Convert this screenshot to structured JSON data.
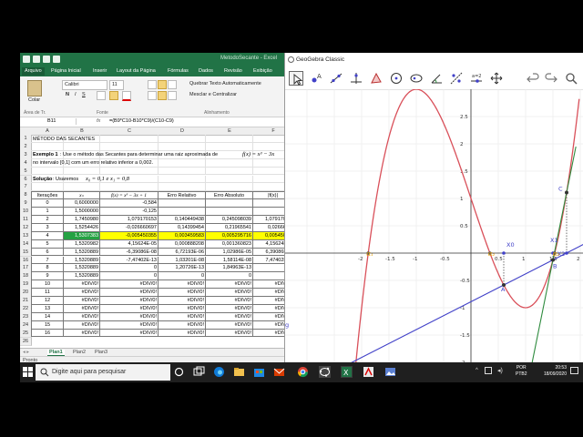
{
  "excel": {
    "title": "MetodoSecante - Excel",
    "tabs": [
      "Arquivo",
      "Página Inicial",
      "Inserir",
      "Layout da Página",
      "Fórmulas",
      "Dados",
      "Revisão",
      "Exibição"
    ],
    "ribbon": {
      "paste": "Colar",
      "font_name": "Calibri",
      "font_size": "11",
      "wrap_text": "Quebrar Texto Automaticamente",
      "merge_center": "Mesclar e Centralizar",
      "group_clipboard": "Área de Tr.",
      "group_font": "Fonte",
      "group_alignment": "Alinhamento"
    },
    "name_box": "B11",
    "fx": "fx",
    "formula": "=(B9*C10-B10*C9)/(C10-C9)",
    "columns": [
      "A",
      "B",
      "C",
      "D",
      "E",
      "F"
    ],
    "rows": [
      "1",
      "2",
      "3",
      "4",
      "5",
      "6",
      "7",
      "8",
      "9",
      "10",
      "11",
      "12",
      "13",
      "14",
      "15",
      "16",
      "17",
      "18",
      "19",
      "20",
      "21",
      "22",
      "23",
      "24",
      "25",
      "26"
    ],
    "heading": "MÉTODO DAS SECANTES",
    "exemplo_bold": "Exemplo 1",
    "exemplo_text": ": Use o método das Secantes para determinar uma raiz aproximada de",
    "exemplo_fx": "f(x) = x³ − 3x",
    "interval_text": "no intervalo [0,1] com um erro relativo inferior a 0,002.",
    "solucao_bold": "Solução",
    "solucao_text": ": Usaremos",
    "solucao_values": "x₀ = 0,1  e  x₁ = 0,8",
    "table_headers": [
      "Iterações",
      "xₙ",
      "f(x) = x³ − 3x + 1",
      "Erro Relativo",
      "Erro Absoluto",
      "|f(x)|"
    ],
    "table_rows": [
      [
        "0",
        "0,6000000",
        "-0,584",
        "",
        "",
        ""
      ],
      [
        "1",
        "1,5000000",
        "-0,125",
        "",
        "",
        ""
      ],
      [
        "2",
        "1,7450980",
        "1,079170153",
        "0,140449438",
        "0,245098039",
        "1,07917015"
      ],
      [
        "3",
        "1,5254426",
        "-0,026660697",
        "0,14399454",
        "0,21965541",
        "0,0266606"
      ],
      [
        "4",
        "1,5307383",
        "-0,005450355",
        "0,003459583",
        "0,005295716",
        "0,00545035"
      ],
      [
        "5",
        "1,5320982",
        "4,15624E-05",
        "0,000888208",
        "0,001360823",
        "4,15624E-0"
      ],
      [
        "6",
        "1,5320889",
        "-6,39086E-08",
        "6,72193E-06",
        "1,02986E-05",
        "6,39086E-0"
      ],
      [
        "7",
        "1,5320889",
        "-7,47402E-13",
        "1,03201E-08",
        "1,58114E-08",
        "7,47402E-1"
      ],
      [
        "8",
        "1,5320889",
        "0",
        "1,20726E-13",
        "1,84963E-13",
        "0"
      ],
      [
        "9",
        "1,5320889",
        "0",
        "0",
        "0",
        "0"
      ],
      [
        "10",
        "#DIV/0!",
        "#DIV/0!",
        "#DIV/0!",
        "#DIV/0!",
        "#DIV/0!"
      ],
      [
        "11",
        "#DIV/0!",
        "#DIV/0!",
        "#DIV/0!",
        "#DIV/0!",
        "#DIV/0!"
      ],
      [
        "12",
        "#DIV/0!",
        "#DIV/0!",
        "#DIV/0!",
        "#DIV/0!",
        "#DIV/0!"
      ],
      [
        "13",
        "#DIV/0!",
        "#DIV/0!",
        "#DIV/0!",
        "#DIV/0!",
        "#DIV/0!"
      ],
      [
        "14",
        "#DIV/0!",
        "#DIV/0!",
        "#DIV/0!",
        "#DIV/0!",
        "#DIV/0!"
      ],
      [
        "15",
        "#DIV/0!",
        "#DIV/0!",
        "#DIV/0!",
        "#DIV/0!",
        "#DIV/0!"
      ],
      [
        "16",
        "#DIV/0!",
        "#DIV/0!",
        "#DIV/0!",
        "#DIV/0!",
        "#DIV/0!"
      ]
    ],
    "highlight_row_index": 4,
    "sheets": [
      "Plan1",
      "Plan2",
      "Plan3"
    ],
    "status": "Pronto",
    "colors": {
      "brand": "#217346",
      "highlight": "#ffff00",
      "selected_cell": "#25a243"
    }
  },
  "geogebra": {
    "title": "GeoGebra Classic",
    "tools": [
      "move-tool",
      "point-tool",
      "line-tool",
      "perpendicular-tool",
      "polygon-tool",
      "circle-tool",
      "ellipse-tool",
      "angle-tool",
      "reflect-tool",
      "slider-tool",
      "move-graphics-tool"
    ],
    "slider_label": "a=2",
    "annotations": [
      "x₀ = 0.6",
      "x₁ = 1.5",
      "x₂ = 1.75"
    ],
    "x_ticks": [
      "-2",
      "-1.5",
      "-1",
      "-0.5",
      "0.5",
      "1",
      "1.5",
      "2",
      "2.5",
      "3",
      "3.5"
    ],
    "y_ticks": [
      "2.5",
      "2",
      "1.5",
      "1",
      "0.5",
      "-0.5",
      "-1",
      "-1.5",
      "-2",
      "-2.5"
    ],
    "point_labels": [
      "X0",
      "X1",
      "X2",
      "A",
      "B",
      "C"
    ],
    "root_labels": [
      "α₁",
      "α₂",
      "α₃"
    ],
    "curve_labels": [
      "f",
      "g"
    ],
    "colors": {
      "curve": "#d9505a",
      "secant": "#4141c8",
      "tangent": "#2e8b3e",
      "root": "#e8a000"
    }
  },
  "taskbar": {
    "search_placeholder": "Digite aqui para pesquisar",
    "lang_1": "POR",
    "lang_2": "PTB2",
    "time": "20:53",
    "date": "18/09/2020"
  }
}
